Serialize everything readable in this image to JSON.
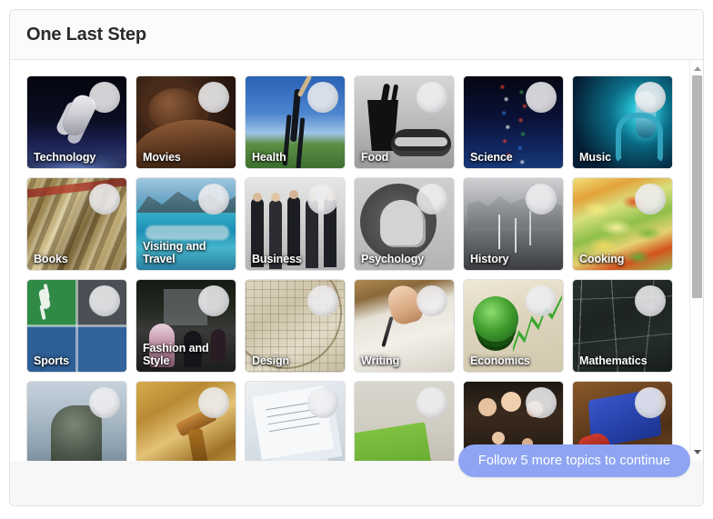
{
  "card": {
    "title": "One Last Step"
  },
  "footer": {
    "follow_button_label": "Follow 5 more topics to continue",
    "button_color": "#8fa5f3",
    "button_text_color": "#ffffff"
  },
  "scrollbar": {
    "up_arrow": "scroll-up-arrow",
    "down_arrow": "scroll-down-arrow",
    "thumb": "scroll-thumb"
  },
  "topics": [
    {
      "label": "Technology",
      "art": "art-technology",
      "follow_toggle": "follow-circle"
    },
    {
      "label": "Movies",
      "art": "art-movies",
      "follow_toggle": "follow-circle"
    },
    {
      "label": "Health",
      "art": "art-health",
      "follow_toggle": "follow-circle"
    },
    {
      "label": "Food",
      "art": "art-food",
      "follow_toggle": "follow-circle"
    },
    {
      "label": "Science",
      "art": "art-science",
      "follow_toggle": "follow-circle"
    },
    {
      "label": "Music",
      "art": "art-music",
      "follow_toggle": "follow-circle"
    },
    {
      "label": "Books",
      "art": "art-books",
      "follow_toggle": "follow-circle"
    },
    {
      "label": "Visiting and Travel",
      "art": "art-travel",
      "follow_toggle": "follow-circle"
    },
    {
      "label": "Business",
      "art": "art-business",
      "follow_toggle": "follow-circle"
    },
    {
      "label": "Psychology",
      "art": "art-psychology",
      "follow_toggle": "follow-circle"
    },
    {
      "label": "History",
      "art": "art-history",
      "follow_toggle": "follow-circle"
    },
    {
      "label": "Cooking",
      "art": "art-cooking",
      "follow_toggle": "follow-circle"
    },
    {
      "label": "Sports",
      "art": "art-sports",
      "follow_toggle": "follow-circle"
    },
    {
      "label": "Fashion and Style",
      "art": "art-fashion",
      "follow_toggle": "follow-circle"
    },
    {
      "label": "Design",
      "art": "art-design",
      "follow_toggle": "follow-circle"
    },
    {
      "label": "Writing",
      "art": "art-writing",
      "follow_toggle": "follow-circle"
    },
    {
      "label": "Economics",
      "art": "art-economics",
      "follow_toggle": "follow-circle"
    },
    {
      "label": "Mathematics",
      "art": "art-mathematics",
      "follow_toggle": "follow-circle"
    },
    {
      "label": "",
      "art": "art-thinker",
      "follow_toggle": "follow-circle"
    },
    {
      "label": "",
      "art": "art-law",
      "follow_toggle": "follow-circle"
    },
    {
      "label": "",
      "art": "art-forms",
      "follow_toggle": "follow-circle"
    },
    {
      "label": "",
      "art": "art-marketing",
      "follow_toggle": "follow-circle"
    },
    {
      "label": "",
      "art": "art-family",
      "follow_toggle": "follow-circle"
    },
    {
      "label": "",
      "art": "art-graduation",
      "follow_toggle": "follow-circle"
    }
  ]
}
